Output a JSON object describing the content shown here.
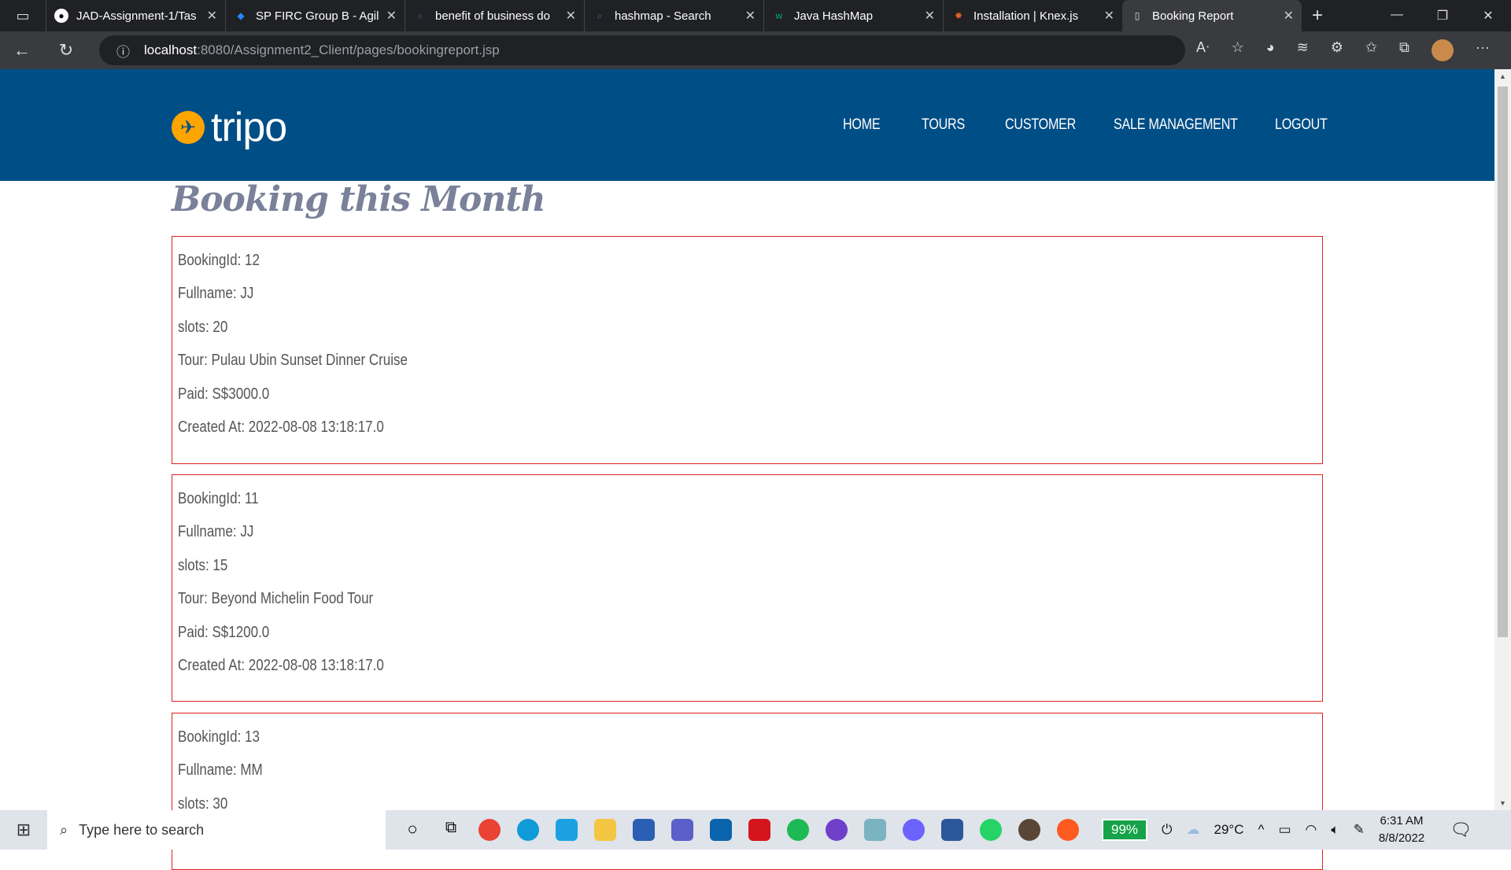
{
  "browser": {
    "tabs": [
      {
        "title": "JAD-Assignment-1/Tas",
        "icon": "github-icon"
      },
      {
        "title": "SP FIRC Group B - Agil",
        "icon": "jira-icon"
      },
      {
        "title": "benefit of business do",
        "icon": "search-icon"
      },
      {
        "title": "hashmap - Search",
        "icon": "search-icon"
      },
      {
        "title": "Java HashMap",
        "icon": "w3schools-icon"
      },
      {
        "title": "Installation | Knex.js",
        "icon": "knex-icon"
      },
      {
        "title": "Booking Report",
        "icon": "page-icon",
        "active": true
      }
    ],
    "url_host": "localhost",
    "url_path": ":8080/Assignment2_Client/pages/bookingreport.jsp"
  },
  "site": {
    "logo": "tripo",
    "nav": [
      "HOME",
      "TOURS",
      "CUSTOMER",
      "SALE MANAGEMENT",
      "LOGOUT"
    ],
    "brand_color": "#004e86",
    "accent_color": "#ffa500"
  },
  "page": {
    "title": "Booking this Month",
    "bookings": [
      {
        "id": "BookingId: 12",
        "name": "Fullname: JJ",
        "slots": "slots: 20",
        "tour": "Tour: Pulau Ubin Sunset Dinner Cruise",
        "paid": "Paid: S$3000.0",
        "created": "Created At: 2022-08-08 13:18:17.0"
      },
      {
        "id": "BookingId: 11",
        "name": "Fullname: JJ",
        "slots": "slots: 15",
        "tour": "Tour: Beyond Michelin Food Tour",
        "paid": "Paid: S$1200.0",
        "created": "Created At: 2022-08-08 13:18:17.0"
      },
      {
        "id": "BookingId: 13",
        "name": "Fullname: MM",
        "slots": "slots: 30"
      }
    ]
  },
  "taskbar": {
    "search_placeholder": "Type here to search",
    "battery": "99%",
    "weather": "29°C",
    "time": "6:31 AM",
    "date": "8/8/2022"
  }
}
